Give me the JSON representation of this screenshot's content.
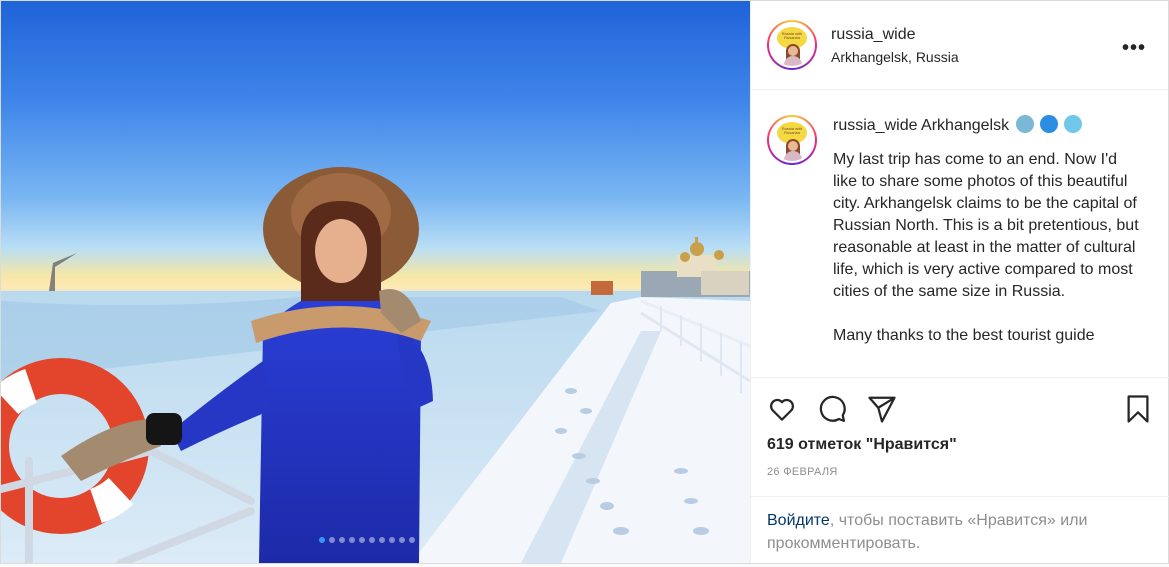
{
  "post": {
    "username": "russia_wide",
    "location": "Arkhangelsk, Russia",
    "more_label": "•••",
    "avatar_text": "Russia with Rusanka",
    "caption": {
      "username": "russia_wide",
      "title": "Arkhangelsk",
      "emojis": [
        "cold-face",
        "wave",
        "snowflake"
      ],
      "text": "My last trip has come to an end. Now I'd like to share some photos of this beautiful city. Arkhangelsk claims to be the capital of Russian North. This is a bit pretentious, but reasonable at least in the matter of cultural life, which is very active compared to most cities of the same size in Russia.\n\nMany thanks to the best tourist guide"
    },
    "likes": "619 отметок \"Нравится\"",
    "date": "26 ФЕВРАЛЯ",
    "login": {
      "link": "Войдите",
      "rest": ", чтобы поставить «Нравится» или прокомментировать."
    },
    "carousel": {
      "count": 10,
      "active_index": 0
    },
    "colors": {
      "accent": "#3897f0",
      "link": "#00376b",
      "muted": "#8e8e8e"
    }
  }
}
